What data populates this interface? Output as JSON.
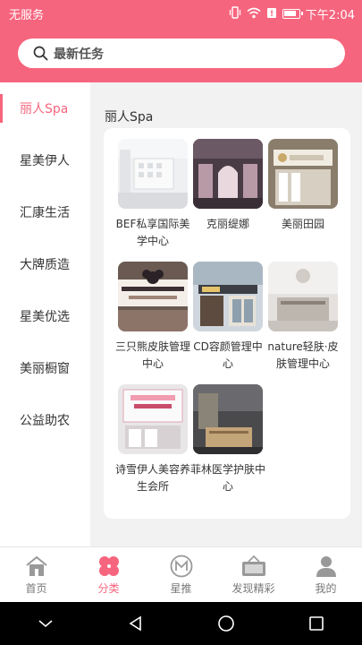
{
  "status_bar": {
    "carrier": "无服务",
    "time": "下午2:04",
    "battery_level": 0.85
  },
  "search": {
    "placeholder": "最新任务"
  },
  "sidebar": {
    "items": [
      {
        "label": "丽人Spa",
        "active": true
      },
      {
        "label": "星美伊人",
        "active": false
      },
      {
        "label": "汇康生活",
        "active": false
      },
      {
        "label": "大牌质造",
        "active": false
      },
      {
        "label": "星美优选",
        "active": false
      },
      {
        "label": "美丽橱窗",
        "active": false
      },
      {
        "label": "公益助农",
        "active": false
      }
    ]
  },
  "content": {
    "category_title": "丽人Spa",
    "shops": [
      {
        "name": "BEF私享国际美学中心"
      },
      {
        "name": "克丽缇娜"
      },
      {
        "name": "美丽田园"
      },
      {
        "name": "三只熊皮肤管理中心"
      },
      {
        "name": "CD容颜管理中心"
      },
      {
        "name": "nature轻肤·皮肤管理中心"
      },
      {
        "name": "诗雪伊人美容养生会所"
      },
      {
        "name": "菲林医学护肤中心"
      }
    ]
  },
  "bottom_nav": {
    "items": [
      {
        "label": "首页",
        "icon": "home-icon",
        "active": false
      },
      {
        "label": "分类",
        "icon": "category-icon",
        "active": true
      },
      {
        "label": "星推",
        "icon": "star-recommend-icon",
        "active": false
      },
      {
        "label": "发现精彩",
        "icon": "discover-icon",
        "active": false
      },
      {
        "label": "我的",
        "icon": "profile-icon",
        "active": false
      }
    ]
  },
  "colors": {
    "accent": "#f6657e",
    "panel_bg": "#f2f2f2",
    "nav_inactive": "#777777"
  }
}
